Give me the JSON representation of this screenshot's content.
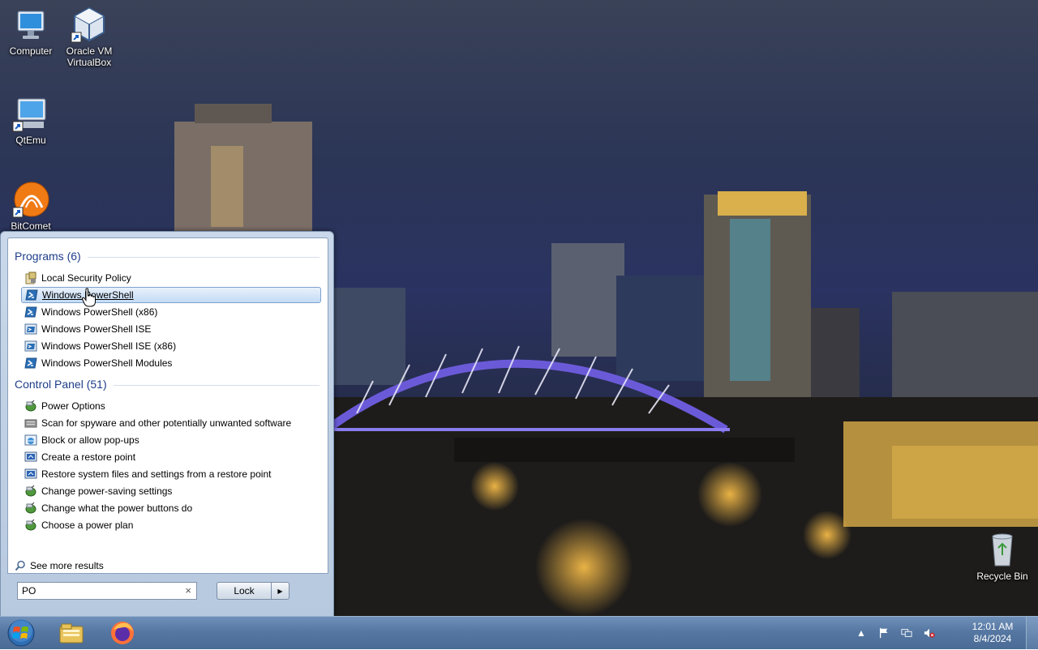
{
  "desktop": {
    "icons": [
      {
        "label": "Computer",
        "icon": "computer-icon"
      },
      {
        "label": "Oracle VM\nVirtualBox",
        "icon": "virtualbox-icon"
      },
      {
        "label": "QtEmu",
        "icon": "qtemu-icon"
      },
      {
        "label": "BitComet",
        "icon": "bitcomet-icon"
      },
      {
        "label": "Recycle Bin",
        "icon": "recycle-bin-icon"
      }
    ]
  },
  "start_menu": {
    "programs": {
      "header": "Programs (6)",
      "items": [
        {
          "label": "Local Security Policy",
          "icon": "security-policy-icon"
        },
        {
          "label": "Windows PowerShell",
          "icon": "powershell-icon",
          "selected": true
        },
        {
          "label": "Windows PowerShell (x86)",
          "icon": "powershell-icon"
        },
        {
          "label": "Windows PowerShell ISE",
          "icon": "powershell-ise-icon"
        },
        {
          "label": "Windows PowerShell ISE (x86)",
          "icon": "powershell-ise-icon"
        },
        {
          "label": "Windows PowerShell Modules",
          "icon": "powershell-icon"
        }
      ]
    },
    "control_panel": {
      "header": "Control Panel (51)",
      "items": [
        {
          "label": "Power Options",
          "icon": "power-options-icon"
        },
        {
          "label": "Scan for spyware and other potentially unwanted software",
          "icon": "defender-icon"
        },
        {
          "label": "Block or allow pop-ups",
          "icon": "internet-options-icon"
        },
        {
          "label": "Create a restore point",
          "icon": "system-icon"
        },
        {
          "label": "Restore system files and settings from a restore point",
          "icon": "system-icon"
        },
        {
          "label": "Change power-saving settings",
          "icon": "power-options-icon"
        },
        {
          "label": "Change what the power buttons do",
          "icon": "power-options-icon"
        },
        {
          "label": "Choose a power plan",
          "icon": "power-options-icon"
        }
      ]
    },
    "see_more": "See more results",
    "search": {
      "value": "PO",
      "clear": "×"
    },
    "lock_label": "Lock"
  },
  "taskbar": {
    "pinned": [
      "windows-explorer-icon",
      "firefox-icon"
    ],
    "clock_time": "12:01 AM",
    "clock_date": "8/4/2024",
    "tray": [
      "show-hidden-icons",
      "action-center-flag-icon",
      "network-icon",
      "volume-muted-icon"
    ]
  },
  "colors": {
    "header_text": "#1e3d8a",
    "selection": "#c4dbf5",
    "taskbar": "#5577a2"
  }
}
